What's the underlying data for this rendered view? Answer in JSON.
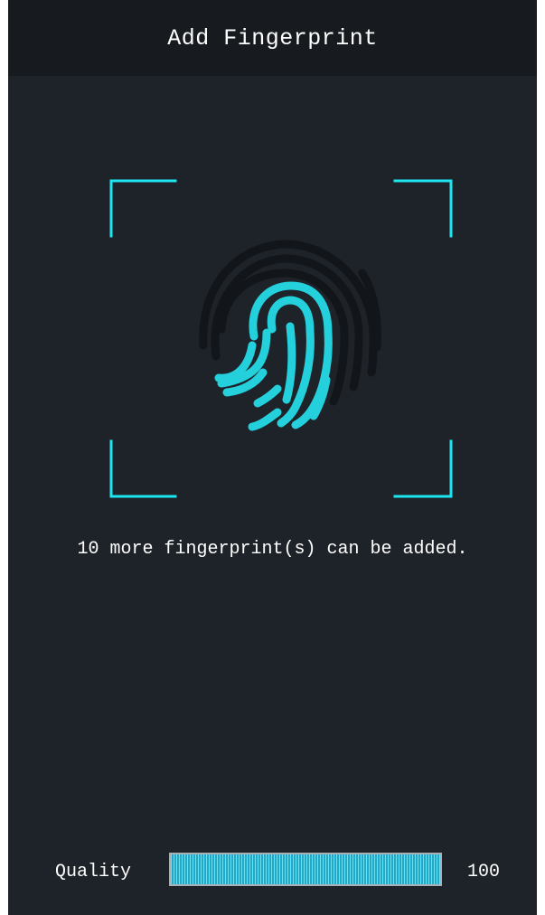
{
  "header": {
    "title": "Add Fingerprint"
  },
  "scanner": {
    "icon": "fingerprint-icon",
    "frame_color": "#1ee6f0",
    "fingerprint_color": "#23d0dc",
    "fingerprint_shadow_color": "#12161a"
  },
  "status": {
    "message": "10 more fingerprint(s) can be added."
  },
  "quality": {
    "label": "Quality",
    "value": "100",
    "percent": 100,
    "fill_color": "#2bb9d8"
  },
  "colors": {
    "background": "#1e2329",
    "header_background": "#171b20",
    "text": "#ffffff"
  }
}
